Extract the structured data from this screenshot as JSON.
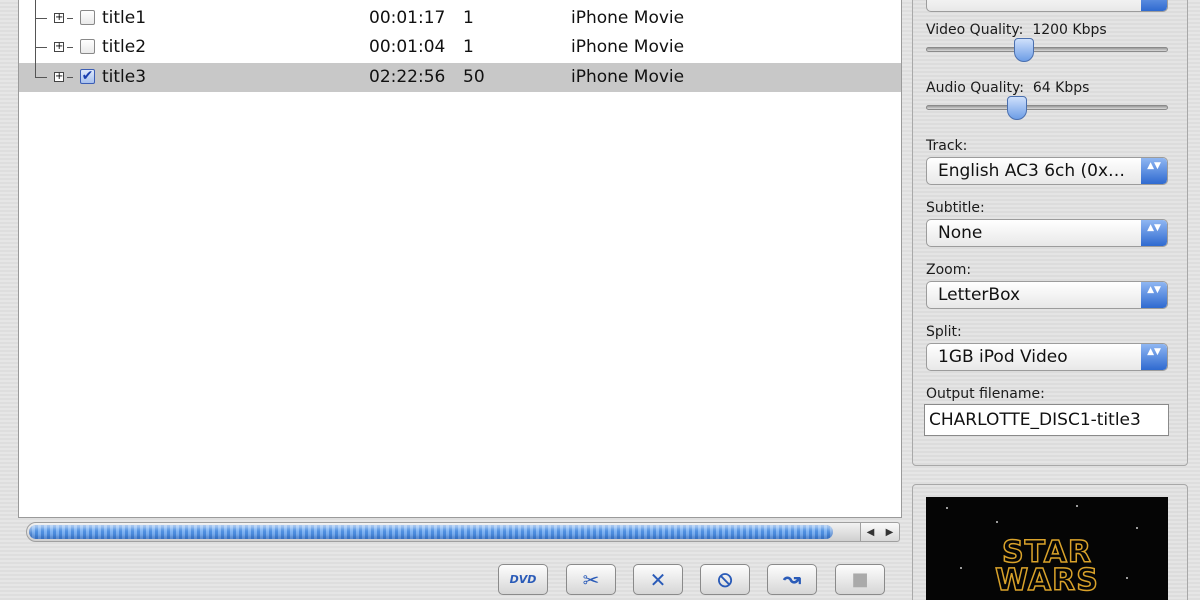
{
  "titles": [
    {
      "name": "title1",
      "time": "00:01:17",
      "count": "1",
      "format": "iPhone Movie",
      "checked": false
    },
    {
      "name": "title2",
      "time": "00:01:04",
      "count": "1",
      "format": "iPhone Movie",
      "checked": false
    },
    {
      "name": "title3",
      "time": "02:22:56",
      "count": "50",
      "format": "iPhone Movie",
      "checked": true
    }
  ],
  "checkmark": "✔",
  "expander": "+",
  "progress": {
    "percent": 96
  },
  "scroll": {
    "left": "◀",
    "right": "▶"
  },
  "toolbar": {
    "dvd_label": "DVD",
    "cut_icon": "✂",
    "remove_icon": "✕",
    "cancel_icon": "⦸",
    "go_icon": "↝",
    "stop_icon": "■"
  },
  "settings": {
    "video_quality_label": "Video Quality:",
    "video_quality_value": "1200 Kbps",
    "video_quality_level": 0.4,
    "audio_quality_label": "Audio Quality:",
    "audio_quality_value": "64 Kbps",
    "audio_quality_level": 0.37,
    "track_label": "Track:",
    "track_value": "English AC3 6ch (0x…",
    "subtitle_label": "Subtitle:",
    "subtitle_value": "None",
    "zoom_label": "Zoom:",
    "zoom_value": "LetterBox",
    "split_label": "Split:",
    "split_value": "1GB iPod Video",
    "output_label": "Output filename:",
    "output_value": "CHARLOTTE_DISC1-title3",
    "popup_arrows": "▲▼"
  },
  "preview": {
    "logo_line1": "STAR",
    "logo_line2": "WARS"
  },
  "colors": {
    "accent": "#2f6ad0",
    "selection": "#c8c8c8",
    "logo": "#d9a22a"
  }
}
